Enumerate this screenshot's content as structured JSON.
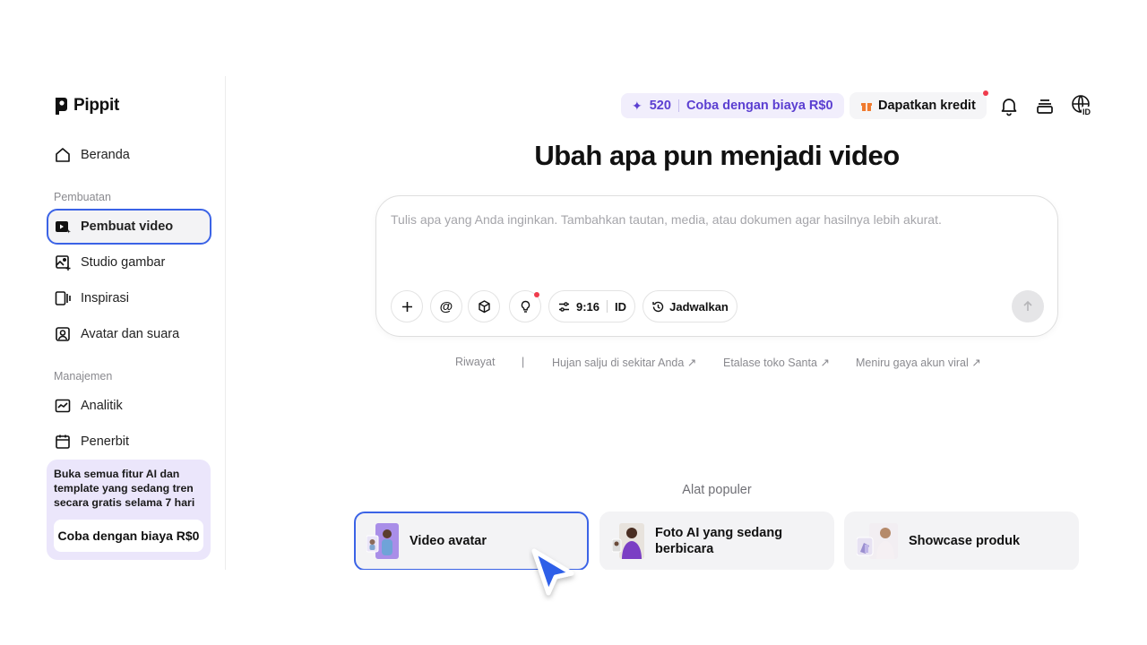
{
  "app": {
    "name": "Pippit"
  },
  "sidebar": {
    "home": {
      "label": "Beranda",
      "icon": "home-icon"
    },
    "sections": [
      {
        "title": "Pembuatan",
        "items": [
          {
            "label": "Pembuat video",
            "icon": "video-maker-icon",
            "active": true
          },
          {
            "label": "Studio gambar",
            "icon": "image-studio-icon"
          },
          {
            "label": "Inspirasi",
            "icon": "inspiration-icon"
          },
          {
            "label": "Avatar dan suara",
            "icon": "avatar-icon"
          }
        ]
      },
      {
        "title": "Manajemen",
        "items": [
          {
            "label": "Analitik",
            "icon": "analytics-icon"
          },
          {
            "label": "Penerbit",
            "icon": "calendar-icon"
          }
        ]
      }
    ],
    "promo": {
      "text": "Buka semua fitur AI dan template yang sedang tren secara gratis selama 7 hari",
      "button": "Coba dengan biaya R$0"
    }
  },
  "header": {
    "credits": "520",
    "trial_label": "Coba dengan biaya R$0",
    "get_credits": "Dapatkan kredit",
    "icons": [
      "bell-icon",
      "layers-icon",
      "globe-id-icon"
    ]
  },
  "main": {
    "title": "Ubah apa pun menjadi video",
    "prompt": {
      "placeholder": "Tulis apa yang Anda inginkan. Tambahkan tautan, media, atau dokumen agar hasilnya lebih akurat.",
      "value": "",
      "ratio": "9:16",
      "language": "ID",
      "schedule": "Jadwalkan"
    },
    "suggestions": {
      "history": "Riwayat",
      "separator": "|",
      "items": [
        "Hujan salju di sekitar Anda ↗",
        "Etalase toko Santa ↗",
        "Meniru gaya akun viral ↗"
      ]
    },
    "popular": {
      "title": "Alat populer",
      "tools": [
        {
          "label": "Video avatar",
          "active": true
        },
        {
          "label": "Foto AI yang sedang berbicara"
        },
        {
          "label": "Showcase produk"
        }
      ]
    }
  },
  "colors": {
    "accent": "#3b63e6",
    "credit_purple": "#5b3fd1",
    "notification": "#ef3b4c"
  }
}
